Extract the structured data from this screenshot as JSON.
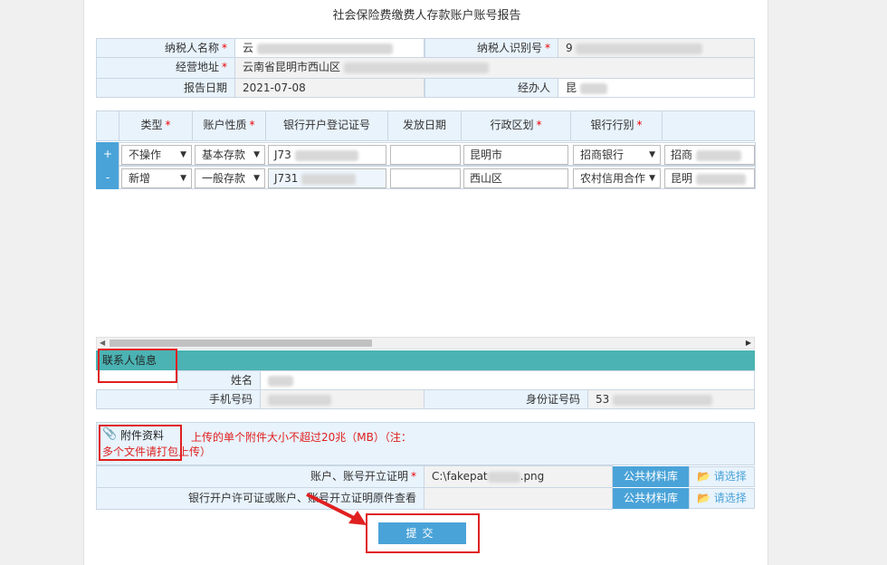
{
  "title": "社会保险费缴费人存款账户账号报告",
  "taxpayer": {
    "name_label": "纳税人名称",
    "name_value": "云",
    "id_label": "纳税人识别号",
    "id_value": "9",
    "address_label": "经营地址",
    "address_value": "云南省昆明市西山区",
    "date_label": "报告日期",
    "date_value": "2021-07-08",
    "handler_label": "经办人",
    "handler_value": "昆"
  },
  "grid": {
    "headers": [
      "类型",
      "账户性质",
      "银行开户登记证号",
      "发放日期",
      "行政区划",
      "银行行别"
    ],
    "required_marks": [
      "*",
      "*",
      "",
      "",
      "*",
      "*"
    ],
    "rows": [
      {
        "action": "+",
        "type": "不操作",
        "nature": "基本存款",
        "reg_no": "J73",
        "issue_date": "",
        "region": "昆明市",
        "bank": "招商银行",
        "branch": "招商"
      },
      {
        "action": "-",
        "type": "新增",
        "nature": "一般存款",
        "reg_no": "J731",
        "issue_date": "",
        "region": "西山区",
        "bank": "农村信用合作",
        "branch": "昆明"
      }
    ]
  },
  "contact": {
    "section_title": "联系人信息",
    "name_label": "姓名",
    "phone_label": "手机号码",
    "idcard_label": "身份证号码",
    "idcard_value": "53"
  },
  "attachment": {
    "title": "附件资料",
    "note_line1": "上传的单个附件大小不超过20兆（MB）（注：",
    "note_line2": "多个文件请打包上传）",
    "rows": [
      {
        "label": "账户、账号开立证明",
        "required": "*",
        "value": "C:\\fakepat",
        "value_suffix": ".png",
        "lib_label": "公共材料库",
        "choose_label": "请选择"
      },
      {
        "label": "银行开户许可证或账户、账号开立证明原件查看",
        "required": "",
        "value": "",
        "value_suffix": "",
        "lib_label": "公共材料库",
        "choose_label": "请选择"
      }
    ]
  },
  "submit_label": "提交",
  "colors": {
    "accent": "#4aa3d8",
    "teal": "#4bb3b3",
    "highlight": "#e02020"
  }
}
